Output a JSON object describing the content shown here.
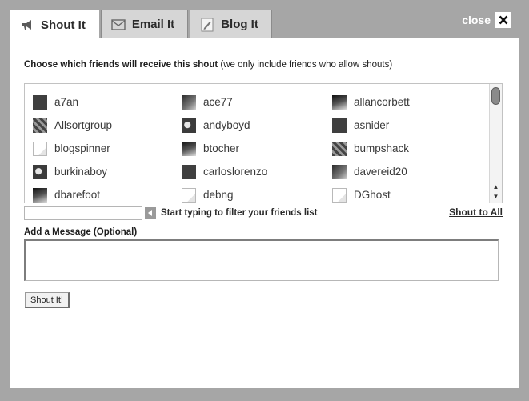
{
  "tabs": [
    {
      "label": "Shout It",
      "icon": "megaphone-icon",
      "active": true
    },
    {
      "label": "Email It",
      "icon": "envelope-icon",
      "active": false
    },
    {
      "label": "Blog It",
      "icon": "blog-pencil-icon",
      "active": false
    }
  ],
  "close": {
    "label": "close"
  },
  "heading": {
    "bold": "Choose which friends will receive this shout",
    "note": " (we only include friends who allow shouts)"
  },
  "friends": [
    {
      "name": "a7an",
      "avatar": "photo"
    },
    {
      "name": "ace77",
      "avatar": "photo"
    },
    {
      "name": "allancorbett",
      "avatar": "photo"
    },
    {
      "name": "Allsortgroup",
      "avatar": "photo"
    },
    {
      "name": "andyboyd",
      "avatar": "photo"
    },
    {
      "name": "asnider",
      "avatar": "photo"
    },
    {
      "name": "blogspinner",
      "avatar": "blank"
    },
    {
      "name": "btocher",
      "avatar": "photo"
    },
    {
      "name": "bumpshack",
      "avatar": "photo"
    },
    {
      "name": "burkinaboy",
      "avatar": "photo"
    },
    {
      "name": "carloslorenzo",
      "avatar": "photo"
    },
    {
      "name": "davereid20",
      "avatar": "photo"
    },
    {
      "name": "dbarefoot",
      "avatar": "photo"
    },
    {
      "name": "debng",
      "avatar": "blank"
    },
    {
      "name": "DGhost",
      "avatar": "blank"
    }
  ],
  "filter": {
    "value": "",
    "hint": "Start typing to filter your friends list"
  },
  "shout_all": "Shout to All",
  "message": {
    "label": "Add a Message (Optional)",
    "value": ""
  },
  "submit_label": "Shout It!",
  "colors": {
    "overlay": "#a6a6a6",
    "panel": "#ffffff",
    "text": "#2b2b2b"
  }
}
